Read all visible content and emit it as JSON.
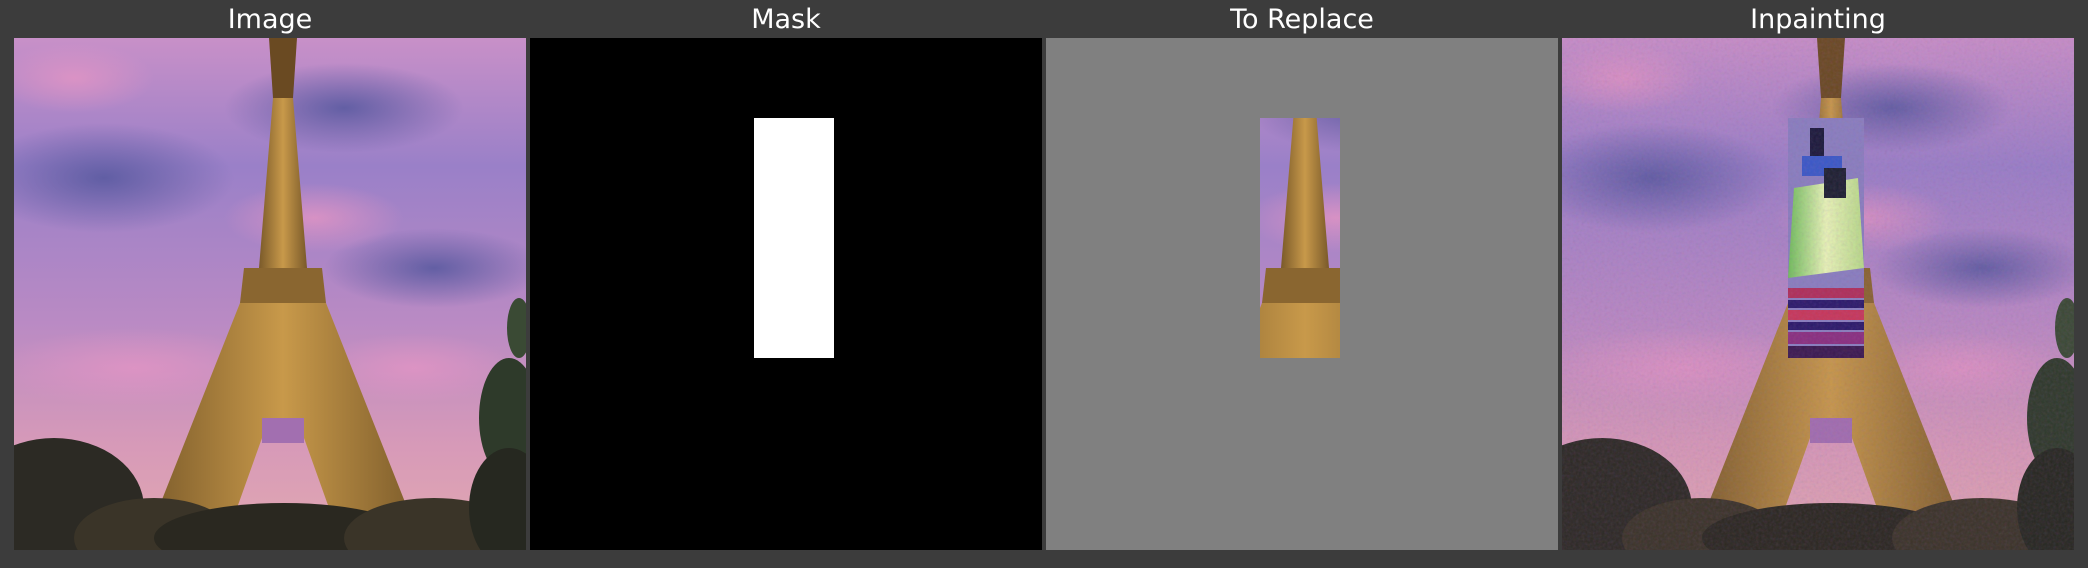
{
  "panels": [
    {
      "title": "Image"
    },
    {
      "title": "Mask"
    },
    {
      "title": "To Replace"
    },
    {
      "title": "Inpainting"
    }
  ],
  "colors": {
    "background": "#3c3c3c",
    "sky_purple": "#8a7bc6",
    "sky_pink": "#d48fb6",
    "tower_gold": "#b08a3e",
    "mask_black": "#000000",
    "mask_white": "#ffffff",
    "replace_gray": "#808080"
  },
  "icons": {
    "panel_1": "eiffel-tower-photo",
    "panel_2": "mask-rectangle",
    "panel_3": "tower-crop",
    "panel_4": "statue-of-liberty-inpaint"
  }
}
